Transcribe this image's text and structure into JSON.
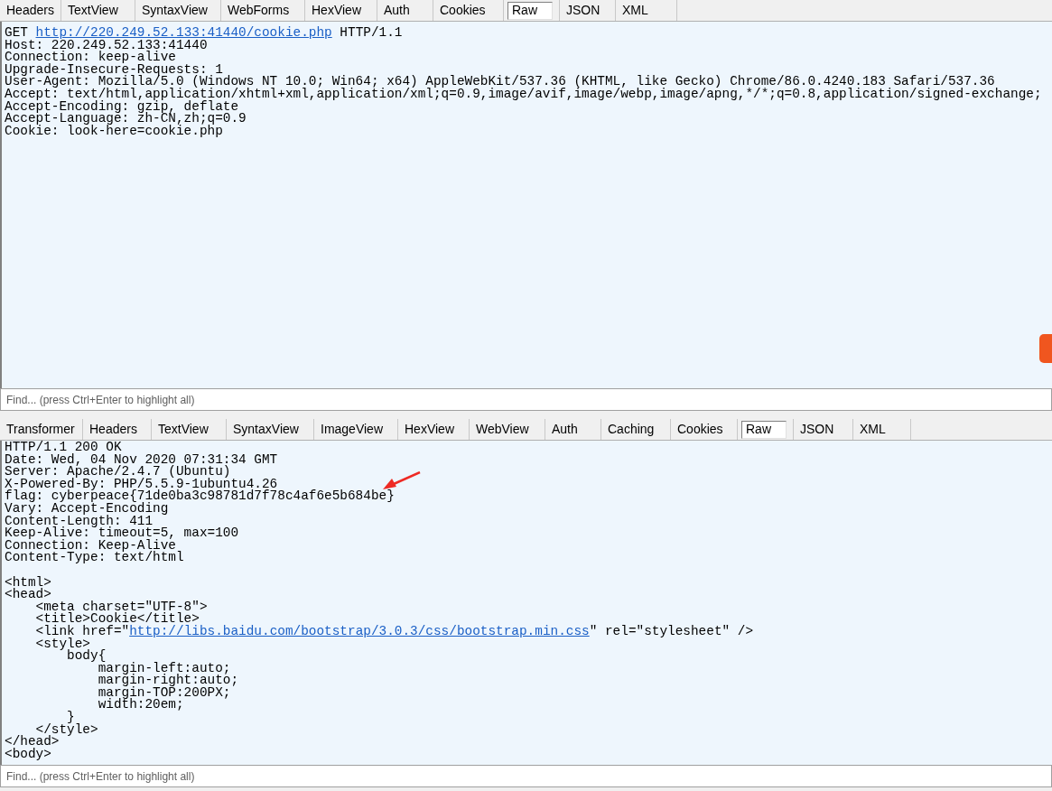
{
  "request": {
    "tabs": [
      {
        "label": "Headers",
        "selected": false
      },
      {
        "label": "TextView",
        "selected": false
      },
      {
        "label": "SyntaxView",
        "selected": false
      },
      {
        "label": "WebForms",
        "selected": false
      },
      {
        "label": "HexView",
        "selected": false
      },
      {
        "label": "Auth",
        "selected": false
      },
      {
        "label": "Cookies",
        "selected": false
      },
      {
        "label": "Raw",
        "selected": true
      },
      {
        "label": "JSON",
        "selected": false
      },
      {
        "label": "XML",
        "selected": false
      }
    ],
    "lines": [
      [
        {
          "text": "GET "
        },
        {
          "text": "http://220.249.52.133:41440/cookie.php",
          "kind": "link"
        },
        {
          "text": " HTTP/1.1"
        }
      ],
      [
        {
          "text": "Host: 220.249.52.133:41440"
        }
      ],
      [
        {
          "text": "Connection: keep-alive"
        }
      ],
      [
        {
          "text": "Upgrade-Insecure-Requests: 1"
        }
      ],
      [
        {
          "text": "User-Agent: Mozilla/5.0 (Windows NT 10.0; Win64; x64) AppleWebKit/537.36 (KHTML, like Gecko) Chrome/86.0.4240.183 Safari/537.36"
        }
      ],
      [
        {
          "text": "Accept: text/html,application/xhtml+xml,application/xml;q=0.9,image/avif,image/webp,image/apng,*/*;q=0.8,application/signed-exchange;"
        }
      ],
      [
        {
          "text": "Accept-Encoding: gzip, deflate"
        }
      ],
      [
        {
          "text": "Accept-Language: zh-CN,zh;q=0.9"
        }
      ],
      [
        {
          "text": "Cookie: look-here=cookie.php"
        }
      ]
    ],
    "find": {
      "placeholder": "Find... (press Ctrl+Enter to highlight all)"
    }
  },
  "response": {
    "tabs": [
      {
        "label": "Transformer",
        "selected": false
      },
      {
        "label": "Headers",
        "selected": false
      },
      {
        "label": "TextView",
        "selected": false
      },
      {
        "label": "SyntaxView",
        "selected": false
      },
      {
        "label": "ImageView",
        "selected": false
      },
      {
        "label": "HexView",
        "selected": false
      },
      {
        "label": "WebView",
        "selected": false
      },
      {
        "label": "Auth",
        "selected": false
      },
      {
        "label": "Caching",
        "selected": false
      },
      {
        "label": "Cookies",
        "selected": false
      },
      {
        "label": "Raw",
        "selected": true
      },
      {
        "label": "JSON",
        "selected": false
      },
      {
        "label": "XML",
        "selected": false
      }
    ],
    "lines": [
      [
        {
          "text": "HTTP/1.1 200 OK"
        }
      ],
      [
        {
          "text": "Date: Wed, 04 Nov 2020 07:31:34 GMT"
        }
      ],
      [
        {
          "text": "Server: Apache/2.4.7 (Ubuntu)"
        }
      ],
      [
        {
          "text": "X-Powered-By: PHP/5.5.9-1ubuntu4.26"
        }
      ],
      [
        {
          "text": "flag: cyberpeace{71de0ba3c98781d7f78c4af6e5b684be}"
        }
      ],
      [
        {
          "text": "Vary: Accept-Encoding"
        }
      ],
      [
        {
          "text": "Content-Length: 411"
        }
      ],
      [
        {
          "text": "Keep-Alive: timeout=5, max=100"
        }
      ],
      [
        {
          "text": "Connection: Keep-Alive"
        }
      ],
      [
        {
          "text": "Content-Type: text/html"
        }
      ],
      [
        {
          "kind": "blank"
        }
      ],
      [
        {
          "text": "<html>"
        }
      ],
      [
        {
          "text": "<head>"
        }
      ],
      [
        {
          "text": "    <meta charset=\"UTF-8\">"
        }
      ],
      [
        {
          "text": "    <title>Cookie</title>"
        }
      ],
      [
        {
          "text": "    <link href=\""
        },
        {
          "text": "http://libs.baidu.com/bootstrap/3.0.3/css/bootstrap.min.css",
          "kind": "link"
        },
        {
          "text": "\" rel=\"stylesheet\" />"
        }
      ],
      [
        {
          "text": "    <style>"
        }
      ],
      [
        {
          "text": "        body{"
        }
      ],
      [
        {
          "text": "            margin-left:auto;"
        }
      ],
      [
        {
          "text": "            margin-right:auto;"
        }
      ],
      [
        {
          "text": "            margin-TOP:200PX;"
        }
      ],
      [
        {
          "text": "            width:20em;"
        }
      ],
      [
        {
          "text": "        }"
        }
      ],
      [
        {
          "text": "    </style>"
        }
      ],
      [
        {
          "text": "</head>"
        }
      ],
      [
        {
          "text": "<body>"
        }
      ]
    ],
    "find": {
      "placeholder": "Find... (press Ctrl+Enter to highlight all)"
    }
  }
}
